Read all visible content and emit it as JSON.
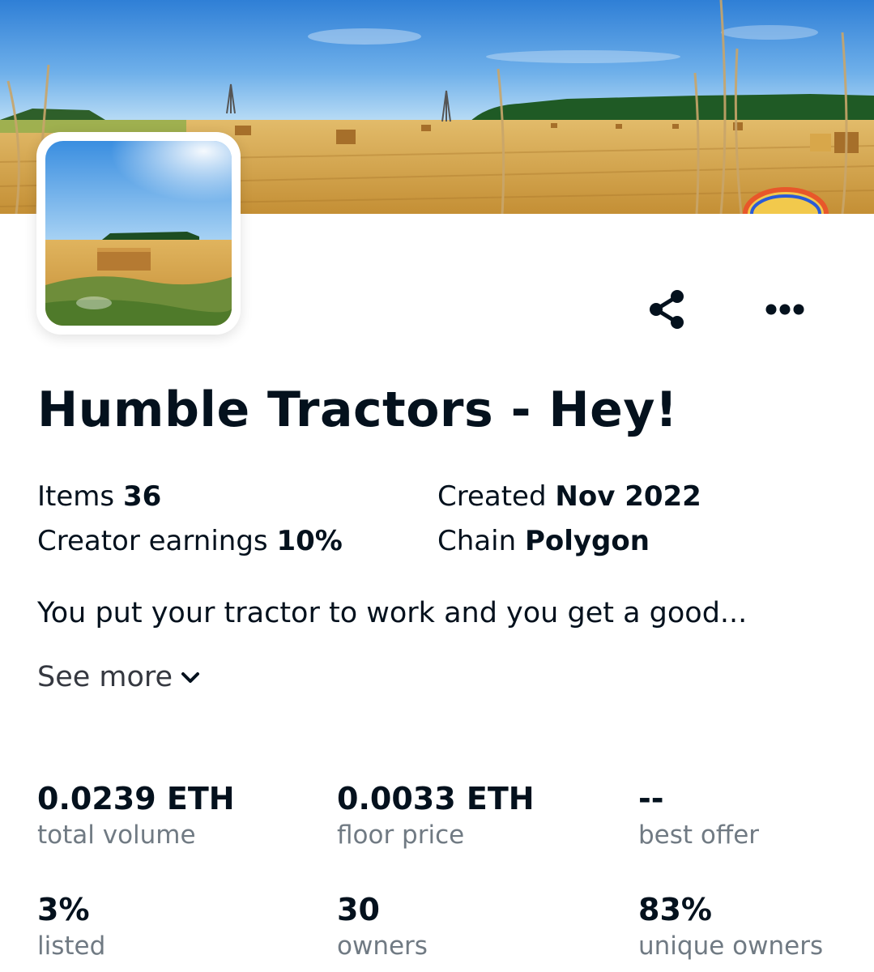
{
  "collection": {
    "title": "Humble Tractors - Hey!",
    "description": "You put your tractor to work and you get a good...",
    "see_more_label": "See more"
  },
  "details": {
    "items_label": "Items",
    "items_value": "36",
    "created_label": "Created",
    "created_value": "Nov 2022",
    "earnings_label": "Creator earnings",
    "earnings_value": "10%",
    "chain_label": "Chain",
    "chain_value": "Polygon"
  },
  "stats": [
    {
      "value": "0.0239 ETH",
      "label": "total volume"
    },
    {
      "value": "0.0033 ETH",
      "label": "floor price"
    },
    {
      "value": "--",
      "label": "best offer"
    },
    {
      "value": "3%",
      "label": "listed"
    },
    {
      "value": "30",
      "label": "owners"
    },
    {
      "value": "83%",
      "label": "unique owners"
    }
  ],
  "icons": {
    "share": "share-icon",
    "more": "more-horizontal-icon",
    "chevron": "chevron-down-icon"
  },
  "colors": {
    "text": "#04111d",
    "secondary_text": "#707a83",
    "sky": "#4a90d8",
    "field": "#d9a84e"
  }
}
